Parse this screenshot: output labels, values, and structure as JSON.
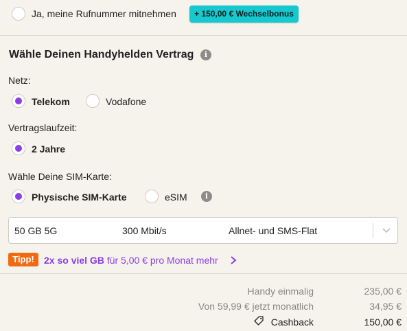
{
  "number_porting": {
    "label": "Ja, meine Rufnummer mitnehmen",
    "checked": false,
    "bonus_badge": "+ 150,00 € Wechselbonus"
  },
  "contract_section": {
    "title": "Wähle Deinen Handyhelden Vertrag",
    "info_icon": "info-icon"
  },
  "network": {
    "label": "Netz:",
    "options": [
      {
        "label": "Telekom",
        "selected": true
      },
      {
        "label": "Vodafone",
        "selected": false
      }
    ]
  },
  "term": {
    "label": "Vertragslaufzeit:",
    "options": [
      {
        "label": "2 Jahre",
        "selected": true
      }
    ]
  },
  "sim": {
    "label": "Wähle Deine SIM-Karte:",
    "options": [
      {
        "label": "Physische SIM-Karte",
        "selected": true
      },
      {
        "label": "eSIM",
        "selected": false
      }
    ],
    "info_icon": "info-icon"
  },
  "tariff_select": {
    "data_volume": "50 GB 5G",
    "speed": "300 Mbit/s",
    "flat": "Allnet- und SMS-Flat",
    "chevron_icon": "chevron-down-icon"
  },
  "tip": {
    "badge": "Tipp!",
    "highlight": "2x so viel GB",
    "text": " für 5,00 € pro Monat mehr",
    "chevron_icon": "chevron-right-icon"
  },
  "summary": {
    "rows": [
      {
        "label": "Handy einmalig",
        "value": "235,00 €"
      },
      {
        "label": "Von 59,99 € jetzt monatlich",
        "value": "34,95 €"
      },
      {
        "label": "Cashback",
        "value": "150,00 €",
        "icon": "tag-icon"
      }
    ]
  },
  "colors": {
    "accent_purple": "#8a3ee6",
    "bonus_teal": "#18c8cf",
    "tip_orange": "#f06a12",
    "background": "#f6f2ec"
  }
}
